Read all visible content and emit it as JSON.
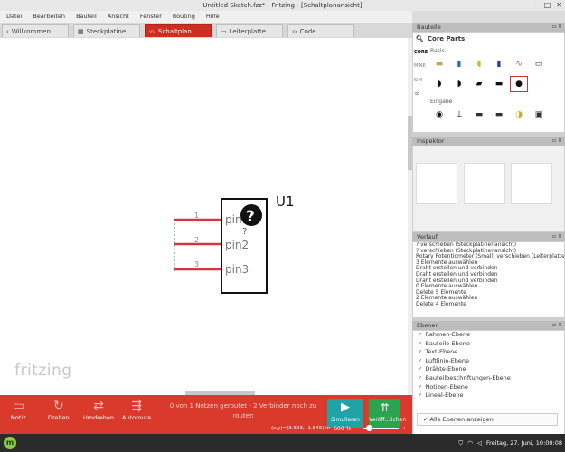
{
  "window": {
    "title": "Untitled Sketch.fzz* - Fritzing - [Schaltplanansicht]",
    "controls": [
      "–",
      "□",
      "✕"
    ]
  },
  "menu": [
    "Datei",
    "Bearbeiten",
    "Bauteil",
    "Ansicht",
    "Fenster",
    "Routing",
    "Hilfe"
  ],
  "tabs": [
    {
      "label": "Willkommen",
      "icon": "‹"
    },
    {
      "label": "Steckplatine",
      "icon": "▦"
    },
    {
      "label": "Schaltplan",
      "icon": "〰",
      "active": true
    },
    {
      "label": "Leiterplatte",
      "icon": "▭"
    },
    {
      "label": "Code",
      "icon": "‹›"
    }
  ],
  "schematic": {
    "part_label": "U1",
    "pins": [
      {
        "number": "1",
        "name": "pin1"
      },
      {
        "number": "2",
        "name": "pin2"
      },
      {
        "number": "3",
        "name": "pin3"
      }
    ],
    "mystery_symbol": "?",
    "mystery_sub": "?",
    "watermark": "fritzing"
  },
  "toolbar": {
    "note": "Notiz",
    "rotate": "Drehen",
    "flip": "Umdrehen",
    "autoroute": "Autoroute",
    "routing_status": "0 von 1 Netzen geroutet - 2 Verbinder noch zu routen",
    "simulate": "Simulieren",
    "publish": "Veröff...lichen",
    "coords": "(x,y)=(3.693, -1.846) in",
    "zoom": "600 %"
  },
  "parts_panel": {
    "title": "Bauteile",
    "bin_title": "Core Parts",
    "bins": [
      "CORE",
      "MINE",
      "SIM",
      "∞"
    ],
    "section_basis": "Basis",
    "section_eingabe": "Eingabe"
  },
  "inspector": {
    "title": "Inspektor"
  },
  "history": {
    "title": "Verlauf",
    "items": [
      "? verschieben (Steckplatinenansicht)",
      "? verschieben (Steckplatinenansicht)",
      "Rotary Potentiometer (Small) verschieben (Leiterplatte)",
      "3 Elemente auswählen",
      "Draht erstellen und verbinden",
      "Draht erstellen und verbinden",
      "Draht erstellen und verbinden",
      "0 Elemente auswählen",
      "Delete 5 Elemente",
      "2 Elemente auswählen",
      "Delete 4 Elemente"
    ]
  },
  "layers": {
    "title": "Ebenen",
    "items": [
      "Rahmen-Ebene",
      "Bauteile-Ebene",
      "Text-Ebene",
      "Luftlinie-Ebene",
      "Drähte-Ebene",
      "Bauteilbeschriftungen-Ebene",
      "Notizen-Ebene",
      "Lineal-Ebene"
    ],
    "show_all": "Alle Ebenen anzeigen"
  },
  "taskbar": {
    "clock": "Freitag, 27. Juni, 10:00:08"
  },
  "colors": {
    "accent": "#d93a2b",
    "wire": "#d9343a",
    "simulate": "#1fa3a6",
    "publish": "#2aa44f"
  }
}
